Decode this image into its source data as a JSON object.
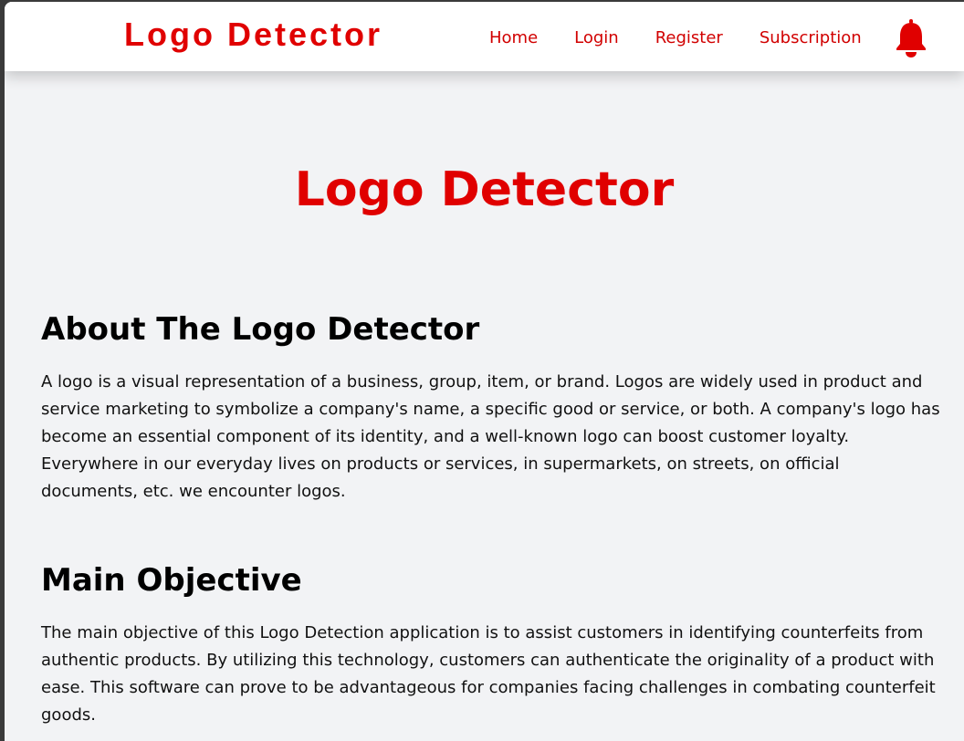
{
  "navbar": {
    "brand": "Logo Detector",
    "links": [
      {
        "label": "Home"
      },
      {
        "label": "Login"
      },
      {
        "label": "Register"
      },
      {
        "label": "Subscription"
      }
    ],
    "notification_icon": "bell-icon",
    "accent_color": "#e00000"
  },
  "hero": {
    "title": "Logo Detector"
  },
  "about": {
    "heading": "About The Logo Detector",
    "text": "A logo is a visual representation of a business, group, item, or brand. Logos are widely used in product and service marketing to symbolize a company's name, a specific good or service, or both. A company's logo has become an essential component of its identity, and a well-known logo can boost customer loyalty. Everywhere in our everyday lives on products or services, in supermarkets, on streets, on official documents, etc. we encounter logos."
  },
  "objective": {
    "heading": "Main Objective",
    "text": "The main objective of this Logo Detection application is to assist customers in identifying counterfeits from authentic products. By utilizing this technology, customers can authenticate the originality of a product with ease. This software can prove to be advantageous for companies facing challenges in combating counterfeit goods."
  }
}
